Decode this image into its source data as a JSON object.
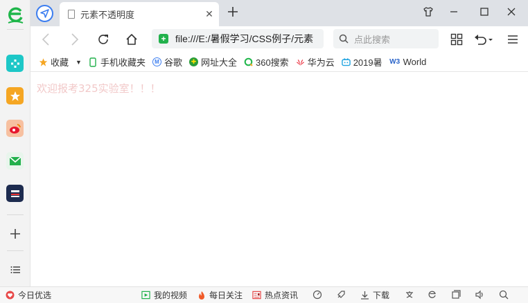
{
  "tab": {
    "title": "元素不透明度"
  },
  "address": {
    "url": "file:///E:/暑假学习/CSS例子/元素"
  },
  "search": {
    "placeholder": "点此搜索"
  },
  "bookmarks": [
    {
      "label": "收藏",
      "icon": "star-icon"
    },
    {
      "label": "手机收藏夹",
      "icon": "phone-icon"
    },
    {
      "label": "谷歌",
      "icon": "google-icon"
    },
    {
      "label": "网址大全",
      "icon": "web-directory-icon"
    },
    {
      "label": "360搜索",
      "icon": "search-360-icon"
    },
    {
      "label": "华为云",
      "icon": "huawei-icon"
    },
    {
      "label": "2019暑",
      "icon": "bilibili-icon"
    },
    {
      "label": "World",
      "icon": "w3-icon"
    }
  ],
  "page": {
    "text": "欢迎报考325实验室！！！",
    "text_color": "#f2c9c9"
  },
  "statusbar": {
    "today": "今日优选",
    "video": "我的视频",
    "follow": "每日关注",
    "news": "热点资讯",
    "download": "下载"
  },
  "colors": {
    "accent": "#3b7df0",
    "brand_green": "#1fb64a"
  }
}
